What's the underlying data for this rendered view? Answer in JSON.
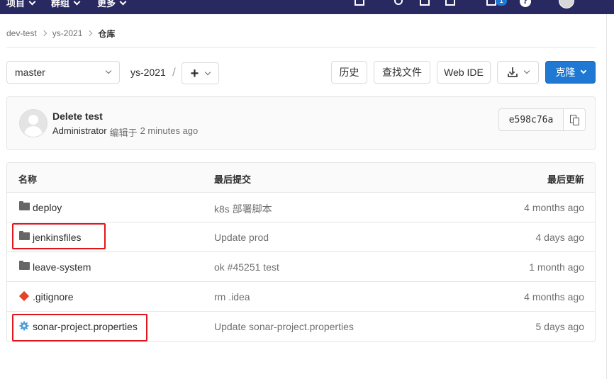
{
  "topnav": {
    "items": [
      {
        "label": "项目"
      },
      {
        "label": "群组"
      },
      {
        "label": "更多"
      }
    ],
    "todo_count": "1",
    "help": "?"
  },
  "breadcrumb": {
    "group": "dev-test",
    "project": "ys-2021",
    "current": "仓库"
  },
  "toolbar": {
    "branch": "master",
    "path": "ys-2021",
    "path_separator": "/",
    "history_label": "历史",
    "find_file_label": "查找文件",
    "web_ide_label": "Web IDE",
    "clone_label": "克隆"
  },
  "last_commit": {
    "title": "Delete test",
    "author": "Administrator",
    "action": "编辑于",
    "time": "2 minutes ago",
    "sha": "e598c76a"
  },
  "file_tree": {
    "columns": {
      "name": "名称",
      "last_commit": "最后提交",
      "last_update": "最后更新"
    },
    "rows": [
      {
        "type": "folder",
        "icon": "folder-icon",
        "name": "deploy",
        "commit": "k8s 部署脚本",
        "updated": "4 months ago"
      },
      {
        "type": "folder",
        "icon": "folder-icon",
        "name": "jenkinsfiles",
        "commit": "Update prod",
        "updated": "4 days ago"
      },
      {
        "type": "folder",
        "icon": "folder-icon",
        "name": "leave-system",
        "commit": "ok #45251 test",
        "updated": "1 month ago"
      },
      {
        "type": "file",
        "icon": "git-icon",
        "name": ".gitignore",
        "commit": "rm .idea",
        "updated": "4 months ago"
      },
      {
        "type": "file",
        "icon": "gear-icon",
        "name": "sonar-project.properties",
        "commit": "Update sonar-project.properties",
        "updated": "5 days ago"
      }
    ]
  },
  "colors": {
    "topbar": "#292961",
    "primary": "#1f78d1",
    "highlight": "#e3151c",
    "git_icon": "#e24329",
    "gear_icon": "#4a9fdb"
  }
}
